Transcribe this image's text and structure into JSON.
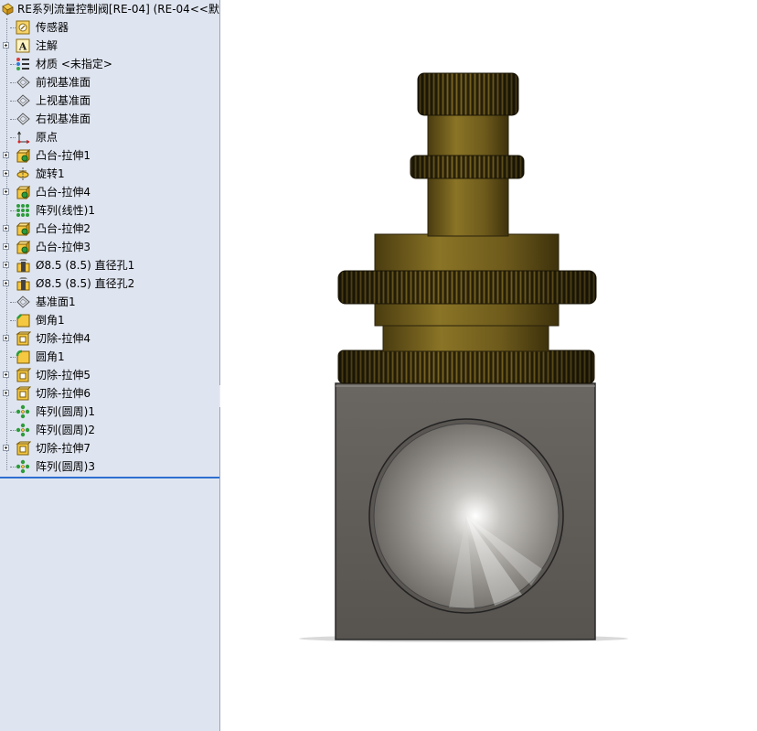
{
  "document": {
    "title": "RE系列流量控制阀[RE-04]  (RE-04<<默",
    "icon": "part-icon"
  },
  "feature_tree": {
    "items": [
      {
        "label": "传感器",
        "icon": "sensor-icon",
        "expandable": false
      },
      {
        "label": "注解",
        "icon": "annotation-icon",
        "expandable": true
      },
      {
        "label": "材质 <未指定>",
        "icon": "material-icon",
        "expandable": false
      },
      {
        "label": "前视基准面",
        "icon": "plane-icon",
        "expandable": false
      },
      {
        "label": "上视基准面",
        "icon": "plane-icon",
        "expandable": false
      },
      {
        "label": "右视基准面",
        "icon": "plane-icon",
        "expandable": false
      },
      {
        "label": "原点",
        "icon": "origin-icon",
        "expandable": false
      },
      {
        "label": "凸台-拉伸1",
        "icon": "boss-extrude-icon",
        "expandable": true
      },
      {
        "label": "旋转1",
        "icon": "revolve-icon",
        "expandable": true
      },
      {
        "label": "凸台-拉伸4",
        "icon": "boss-extrude-icon",
        "expandable": true
      },
      {
        "label": "阵列(线性)1",
        "icon": "linear-pattern-icon",
        "expandable": false
      },
      {
        "label": "凸台-拉伸2",
        "icon": "boss-extrude-icon",
        "expandable": true
      },
      {
        "label": "凸台-拉伸3",
        "icon": "boss-extrude-icon",
        "expandable": true
      },
      {
        "label": "Ø8.5 (8.5) 直径孔1",
        "icon": "hole-wizard-icon",
        "expandable": true
      },
      {
        "label": "Ø8.5 (8.5) 直径孔2",
        "icon": "hole-wizard-icon",
        "expandable": true
      },
      {
        "label": "基准面1",
        "icon": "plane-icon",
        "expandable": false
      },
      {
        "label": "倒角1",
        "icon": "chamfer-icon",
        "expandable": false
      },
      {
        "label": "切除-拉伸4",
        "icon": "cut-extrude-icon",
        "expandable": true
      },
      {
        "label": "圆角1",
        "icon": "fillet-icon",
        "expandable": false
      },
      {
        "label": "切除-拉伸5",
        "icon": "cut-extrude-icon",
        "expandable": true
      },
      {
        "label": "切除-拉伸6",
        "icon": "cut-extrude-icon",
        "expandable": true
      },
      {
        "label": "阵列(圆周)1",
        "icon": "circular-pattern-icon",
        "expandable": false
      },
      {
        "label": "阵列(圆周)2",
        "icon": "circular-pattern-icon",
        "expandable": false
      },
      {
        "label": "切除-拉伸7",
        "icon": "cut-extrude-icon",
        "expandable": true
      },
      {
        "label": "阵列(圆周)3",
        "icon": "circular-pattern-icon",
        "expandable": false
      }
    ]
  },
  "colors": {
    "panel_bg": "#dfe5f0",
    "rollback_bar": "#2e6fd0",
    "brass": "#7a6620",
    "brass_dark": "#3a300c",
    "knurl": "#5a4a14",
    "body_gray": "#5e5a56",
    "body_edge": "#2a2a2a"
  }
}
